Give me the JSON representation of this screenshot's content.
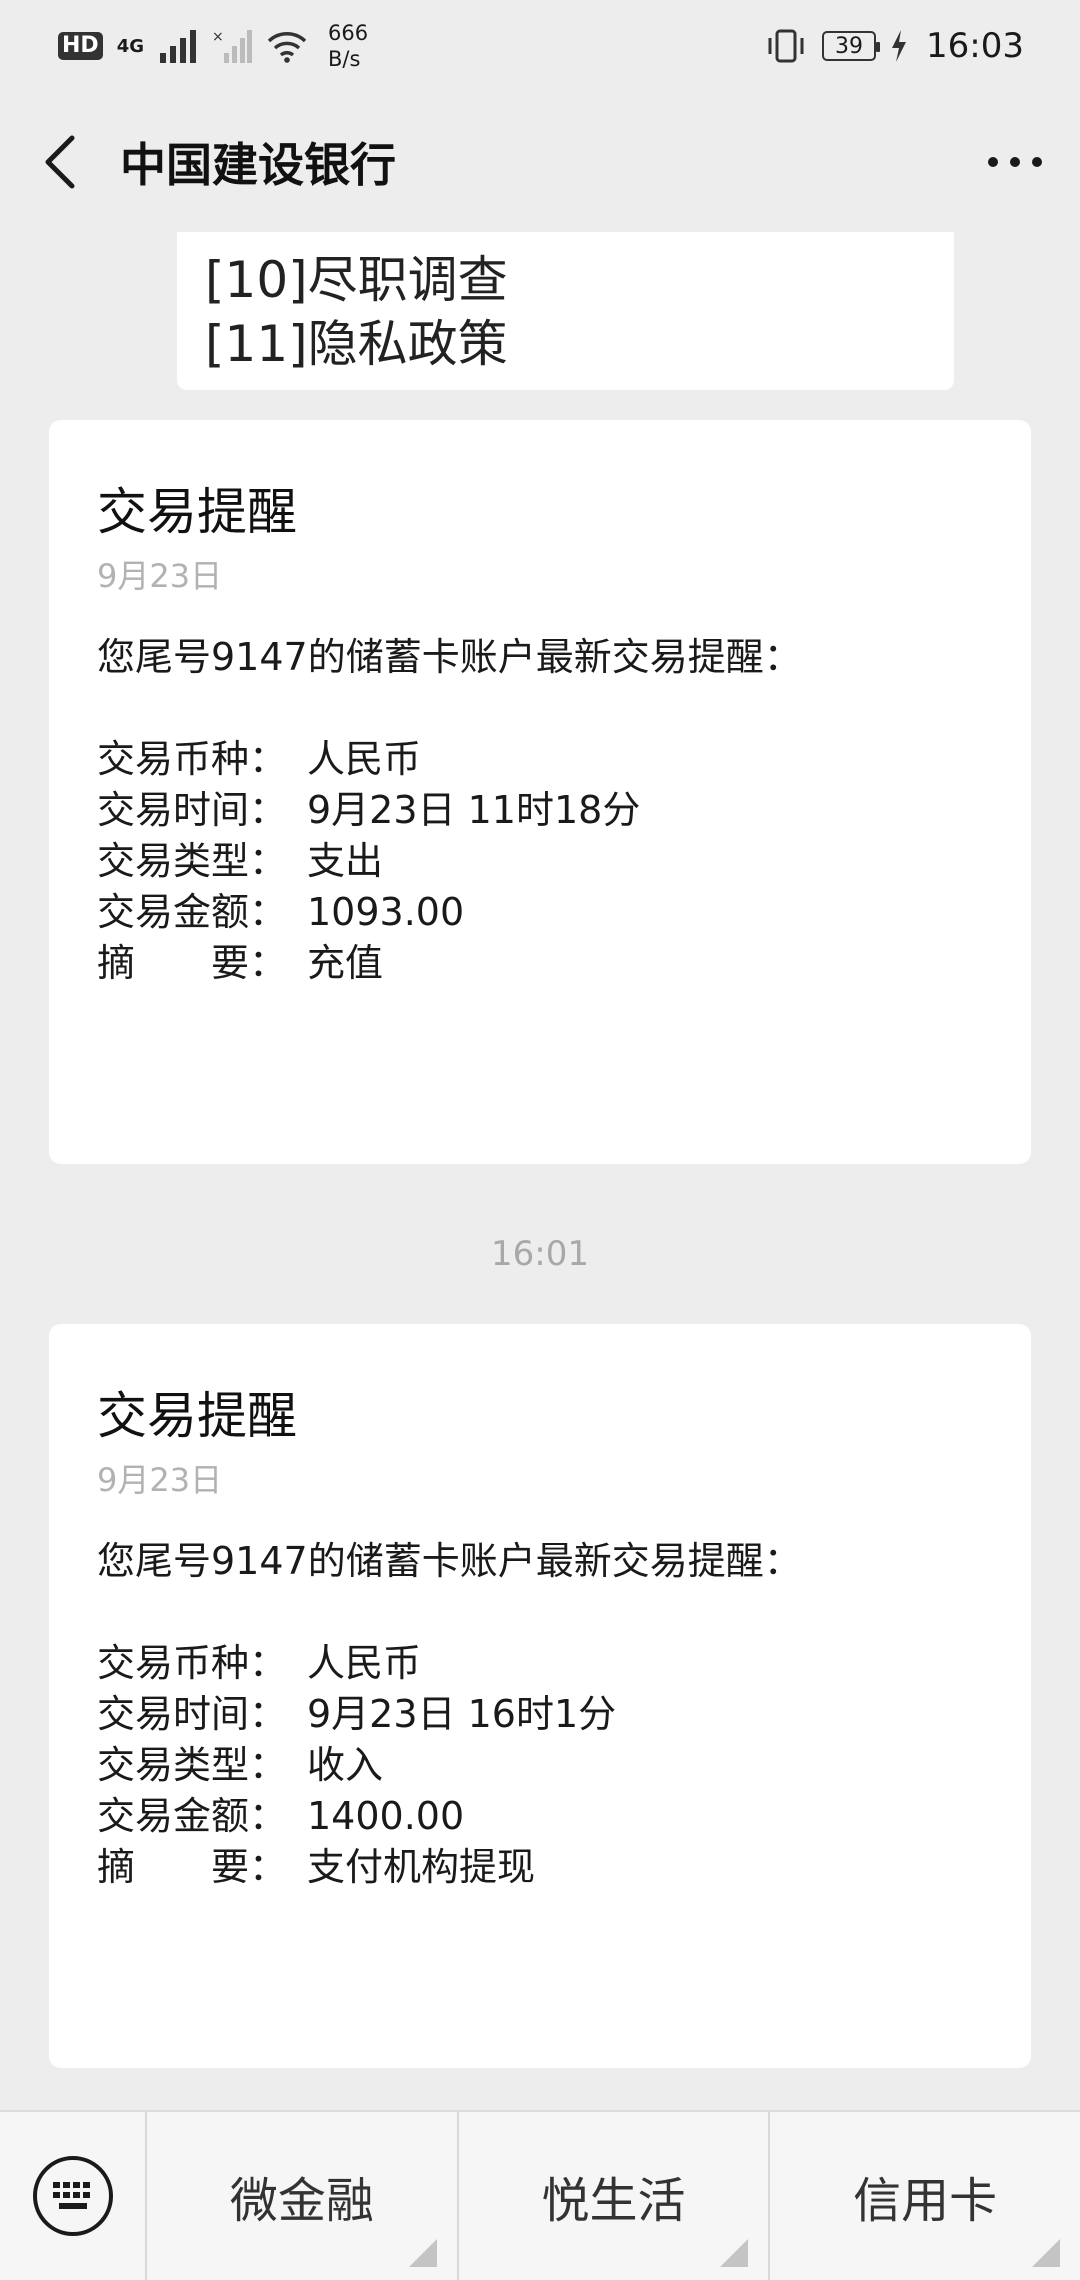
{
  "status_bar": {
    "hd": "HD",
    "network_4g": "4G",
    "net_speed_value": "666",
    "net_speed_unit": "B/s",
    "battery": "39",
    "time": "16:03"
  },
  "nav": {
    "title": "中国建设银行",
    "back_icon": "chevron-left-icon",
    "more_icon": "more-dots-icon"
  },
  "partial_card": {
    "lines": [
      "[10]尽职调查",
      "[11]隐私政策"
    ]
  },
  "messages": [
    {
      "title": "交易提醒",
      "date": "9月23日",
      "intro": "您尾号9147的储蓄卡账户最新交易提醒：",
      "fields": [
        {
          "label": "交易币种：",
          "value": "人民币"
        },
        {
          "label": "交易时间：",
          "value": "9月23日 11时18分"
        },
        {
          "label": "交易类型：",
          "value": "支出"
        },
        {
          "label": "交易金额：",
          "value": "1093.00"
        },
        {
          "label": "摘　　要：",
          "value": "充值"
        }
      ]
    },
    {
      "title": "交易提醒",
      "date": "9月23日",
      "intro": "您尾号9147的储蓄卡账户最新交易提醒：",
      "fields": [
        {
          "label": "交易币种：",
          "value": "人民币"
        },
        {
          "label": "交易时间：",
          "value": "9月23日 16时1分"
        },
        {
          "label": "交易类型：",
          "value": "收入"
        },
        {
          "label": "交易金额：",
          "value": "1400.00"
        },
        {
          "label": "摘　　要：",
          "value": "支付机构提现"
        }
      ]
    }
  ],
  "time_divider": "16:01",
  "bottom_menu": {
    "keyboard_icon": "keyboard-icon",
    "items": [
      {
        "label": "微金融"
      },
      {
        "label": "悦生活"
      },
      {
        "label": "信用卡"
      }
    ]
  }
}
